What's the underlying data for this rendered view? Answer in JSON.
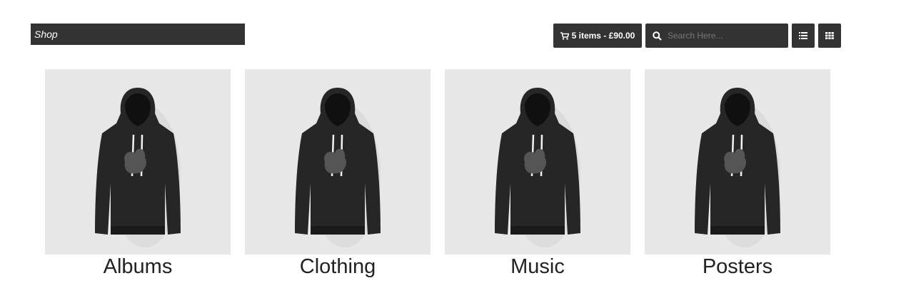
{
  "breadcrumb": {
    "label": "Shop"
  },
  "cart": {
    "label": "5 items - £90.00"
  },
  "search": {
    "placeholder": "Search Here..."
  },
  "categories": [
    {
      "label": "Albums"
    },
    {
      "label": "Clothing"
    },
    {
      "label": "Music"
    },
    {
      "label": "Posters"
    }
  ]
}
